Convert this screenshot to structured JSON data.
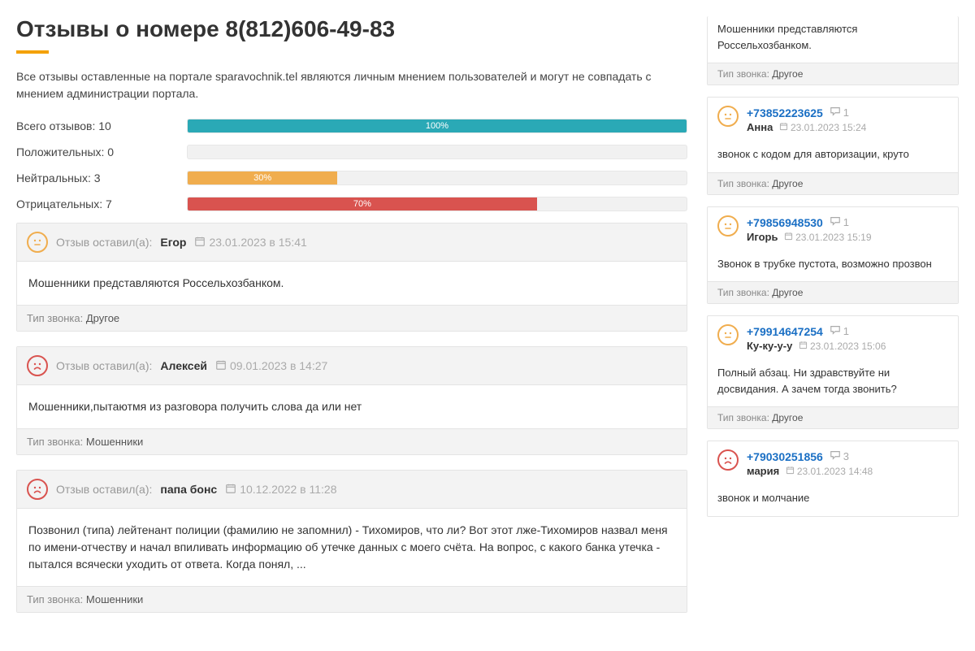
{
  "title": "Отзывы о номере 8(812)606-49-83",
  "intro": "Все отзывы оставленные на портале sparavochnik.tel являются личным мнением пользователей и могут не совпадать с мнением администрации портала.",
  "stats": {
    "total": {
      "label": "Всего отзывов: 10",
      "pct": 100,
      "text": "100%"
    },
    "positive": {
      "label": "Положительных: 0",
      "pct": 0,
      "text": ""
    },
    "neutral": {
      "label": "Нейтральных: 3",
      "pct": 30,
      "text": "30%"
    },
    "negative": {
      "label": "Отрицательных: 7",
      "pct": 70,
      "text": "70%"
    }
  },
  "left_by_label": "Отзыв оставил(а):",
  "call_type_label": "Тип звонка:",
  "reviews": [
    {
      "mood": "neutral",
      "author": "Егор",
      "date": "23.01.2023 в 15:41",
      "body": "Мошенники представляются Россельхозбанком.",
      "call_type": "Другое"
    },
    {
      "mood": "sad",
      "author": "Алексей",
      "date": "09.01.2023 в 14:27",
      "body": "Мошенники,пытаютмя из разговора получить слова да или нет",
      "call_type": "Мошенники"
    },
    {
      "mood": "sad",
      "author": "папа бонс",
      "date": "10.12.2022 в 11:28",
      "body": "Позвонил (типа) лейтенант полиции (фамилию не запомнил) - Тихомиров, что ли? Вот этот лже-Тихомиров назвал меня по имени-отчеству и начал впиливать информацию об утечке данных с моего счёта. На вопрос, с какого банка утечка - пытался всячески уходить от ответа. Когда понял, ...",
      "call_type": "Мошенники"
    }
  ],
  "side": [
    {
      "mood": "",
      "phone": "",
      "comments": "",
      "name": "",
      "date": "",
      "body": "Мошенники представляются Россельхозбанком.",
      "call_type": "Другое",
      "partial": true
    },
    {
      "mood": "neutral",
      "phone": "+73852223625",
      "comments": "1",
      "name": "Анна",
      "date": "23.01.2023 15:24",
      "body": "звонок с кодом для авторизации, круто",
      "call_type": "Другое"
    },
    {
      "mood": "neutral",
      "phone": "+79856948530",
      "comments": "1",
      "name": "Игорь",
      "date": "23.01.2023 15:19",
      "body": "Звонок в трубке пустота, возможно прозвон",
      "call_type": "Другое"
    },
    {
      "mood": "neutral",
      "phone": "+79914647254",
      "comments": "1",
      "name": "Ку-ку-у-у",
      "date": "23.01.2023 15:06",
      "body": "Полный абзац. Ни здравствуйте ни досвидания. А зачем тогда звонить?",
      "call_type": "Другое"
    },
    {
      "mood": "sad",
      "phone": "+79030251856",
      "comments": "3",
      "name": "мария",
      "date": "23.01.2023 14:48",
      "body": "звонок и молчание",
      "call_type": ""
    }
  ]
}
